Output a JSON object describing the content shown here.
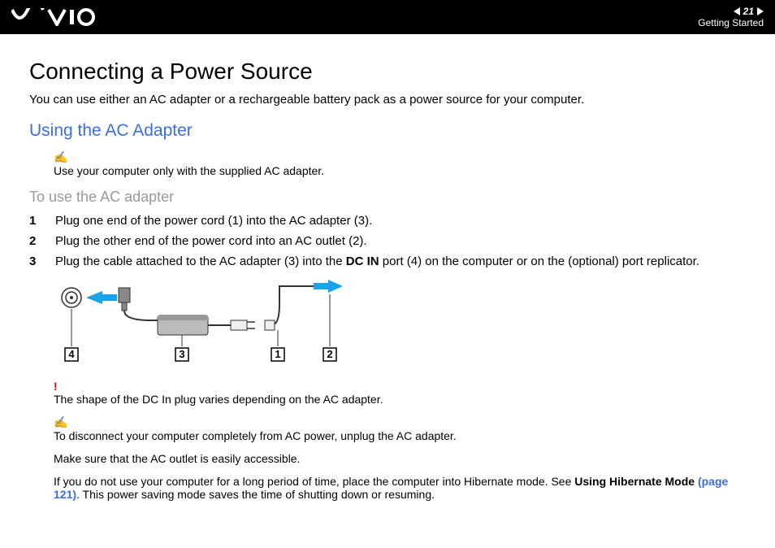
{
  "header": {
    "page_number": "21",
    "section": "Getting Started"
  },
  "title": "Connecting a Power Source",
  "intro": "You can use either an AC adapter or a rechargeable battery pack as a power source for your computer.",
  "subheading": "Using the AC Adapter",
  "note1": "Use your computer only with the supplied AC adapter.",
  "procedure_heading": "To use the AC adapter",
  "steps": [
    {
      "n": "1",
      "text_before": "Plug one end of the power cord (1) into the AC adapter (3)."
    },
    {
      "n": "2",
      "text_before": "Plug the other end of the power cord into an AC outlet (2)."
    },
    {
      "n": "3",
      "text_before": "Plug the cable attached to the AC adapter (3) into the ",
      "bold": "DC IN",
      "text_after": " port (4) on the computer or on the (optional) port replicator."
    }
  ],
  "diagram_labels": {
    "a": "4",
    "b": "3",
    "c": "1",
    "d": "2"
  },
  "warn": "The shape of the DC In plug varies depending on the AC adapter.",
  "note2": "To disconnect your computer completely from AC power, unplug the AC adapter.",
  "note3": "Make sure that the AC outlet is easily accessible.",
  "note4_before": "If you do not use your computer for a long period of time, place the computer into Hibernate mode. See ",
  "note4_bold": "Using Hibernate Mode ",
  "note4_ref": "(page 121)",
  "note4_after": ". This power saving mode saves the time of shutting down or resuming."
}
